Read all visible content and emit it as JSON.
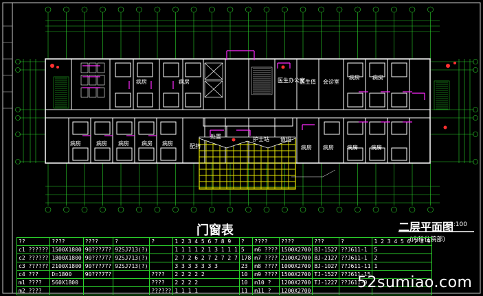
{
  "rooms": {
    "r1": "病房",
    "r2": "病房",
    "r3": "配药",
    "r4": "护士站",
    "r5": "值班",
    "r6": "医生办公室",
    "r7": "医生值",
    "r8": "会诊室",
    "r9": "病房",
    "r10": "病房",
    "r11": "病房",
    "r12": "病房",
    "r13": "病房",
    "r14": "病房",
    "r15": "病房",
    "r16": "病房",
    "r17": "病房",
    "r18": "处置",
    "r19": "病房",
    "r20": "病房"
  },
  "door_table": {
    "title": "门窗表",
    "header": [
      "??",
      "????",
      "????",
      "?",
      "?",
      "1 2 3 4 5 6 7 8 9",
      "?",
      "????",
      "????",
      "???",
      "?",
      "1 2 3 4 5 6 7 8 9"
    ],
    "rows": [
      [
        "c1 ??????",
        "1500X1800",
        "90???77?",
        "92SJ713(?)",
        "",
        "1 1 1 1 2 1 3 1 1 1",
        "5",
        "m6 ????",
        "1500X2700",
        "BJ-1527",
        "??J611-1",
        "5"
      ],
      [
        "c2 ??????",
        "1800X1800",
        "90???77?",
        "92SJ713(?)",
        "",
        "2 7 2 6 2 7 2 7 2 7",
        "178",
        "m7 ????",
        "2100X2700",
        "BJ-2127",
        "??J611-1",
        "2"
      ],
      [
        "c3 ??????",
        "2100X1800",
        "90???77?",
        "92SJ713(?)",
        "",
        "3 3 3 3 3 3 3",
        "23",
        "m8 ????",
        "1000X2700",
        "BJ-1027",
        "??J611-11",
        "1"
      ],
      [
        "c4 ???",
        "D=1800",
        "90???77?",
        "",
        "????",
        "2 2 2 2 2",
        "10",
        "m9 ????",
        "1500X2700",
        "TJ-1527",
        "??J611-15",
        ""
      ],
      [
        "m1 ????",
        "560X1800",
        "",
        "",
        "????",
        "2 2 2 2",
        "10",
        "m10 ?",
        "1200X2700",
        "TJ-1227",
        "??J611-9",
        ""
      ],
      [
        "m2 ????",
        "",
        "",
        "",
        "??????",
        "1 1 1 1",
        "11",
        "m11 ?",
        "1200X2700",
        "",
        "",
        ""
      ]
    ]
  },
  "plan_title": "二层平面图",
  "plan_scale": "1:100",
  "plan_subtitle": "(内科住院部)",
  "watermark": "52sumiao.com"
}
